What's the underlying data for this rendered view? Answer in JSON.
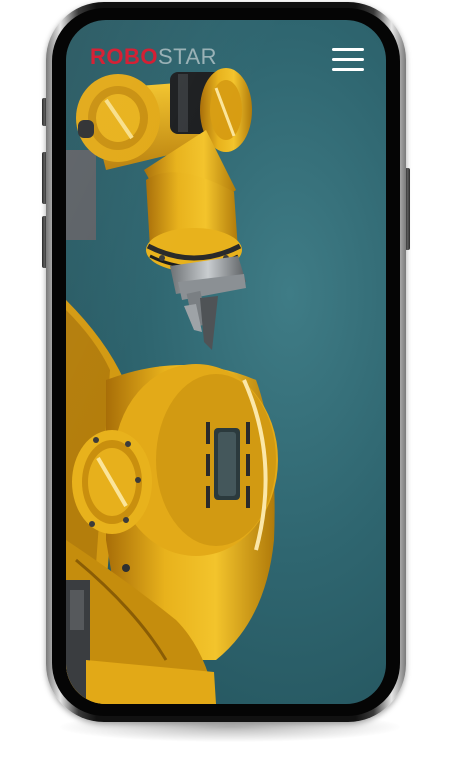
{
  "app": {
    "logo_part_a": "ROBO",
    "logo_part_b": "STAR"
  },
  "header": {
    "menu_icon": "hamburger-menu-icon"
  },
  "hero": {
    "image_subject": "yellow-industrial-robot-arm"
  },
  "colors": {
    "brand_red": "#d3192e",
    "robot_yellow": "#e8b21c",
    "background_teal": "#2f6670"
  }
}
